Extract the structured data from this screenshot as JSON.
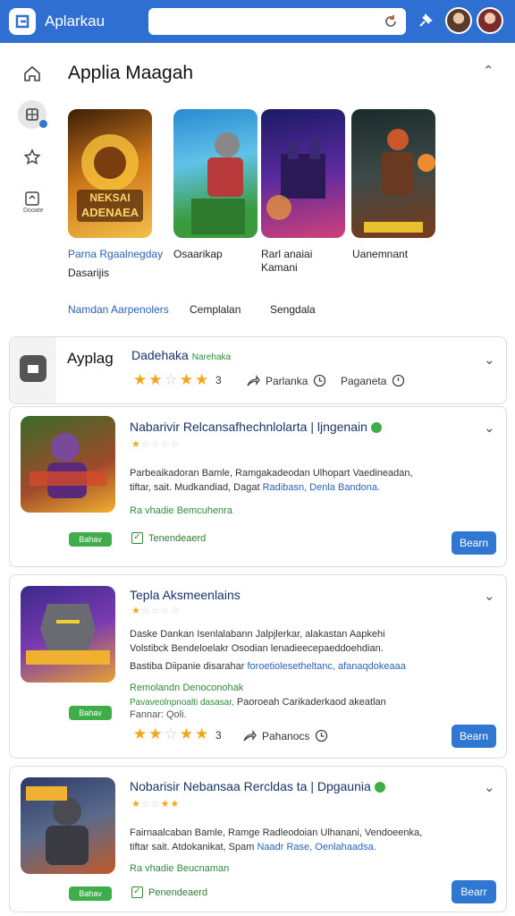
{
  "app": {
    "name": "Aplarkau"
  },
  "search": {
    "placeholder": ""
  },
  "page": {
    "title": "Applia Maagah"
  },
  "sidebar": {
    "apps_label": "Dooate"
  },
  "featured": [
    {
      "title_line1": "Parna Rgaalnegday",
      "title_line2": "Dasarijis",
      "art_text_1": "NEKSAI",
      "art_text_2": "ADENAEA"
    },
    {
      "title_line1": "Osaarikap",
      "title_line2": "",
      "art_text_1": "",
      "art_text_2": ""
    },
    {
      "title_line1": "Rarl anaiai",
      "title_line2": "Kamani",
      "art_text_1": "",
      "art_text_2": ""
    },
    {
      "title_line1": "Uanemnant",
      "title_line2": "",
      "art_text_1": "",
      "art_text_2": ""
    }
  ],
  "tabs": [
    "Namdan Aarpenolers",
    "Cemplalan",
    "Sengdala"
  ],
  "cards": [
    {
      "heading": "Ayplag",
      "title": "Dadehaka",
      "title_tag": "Narehaka",
      "rating_count": "3",
      "meta1": "Parlanka",
      "meta2": "Paganeta"
    },
    {
      "title": "Nabarivir Relcansafhechnlolarta | ljngenain",
      "desc_line1": "Parbeaikadoran Bamle, Ramgakadeodan Ulhopart Vaedineadan,",
      "desc_line2": "tiftar, sait. Mudkandiad, Dagat",
      "desc_link": "Radibasn, Denla Bandona.",
      "green_line": "Ra vhadie Bemcuhenra",
      "pill": "Bahav",
      "check_label": "Tenendeaerd",
      "button": "Bearn"
    },
    {
      "title": "Tepla Aksmeenlains",
      "desc_line1": "Daske Dankan Isenlalabann Jalpjlerkar, alakastan Aapkehi",
      "desc_line2": "Volstibck Bendeloelakr Osodian lenadieecepaeddoehdian.",
      "desc_line3": "Bastiba Diipanie disarahar",
      "desc_link": "foroetiolesetheltanc, afanaqdokeaaa",
      "green_line1": "Remolandn Denoconohak",
      "green_line2": "Pavaveolnpnoalti dasasar,",
      "green_line2_rest": "Paoroeah Carikaderkaod akeatlan",
      "grey_line": "Fannar: Qoli.",
      "pill": "Bahav",
      "rating_count": "3",
      "meta1": "Pahanocs",
      "button": "Bearn"
    },
    {
      "title": "Nobarisir Nebansaa Rercldas ta | Dpgaunia",
      "desc_line1": "Fairnaalcaban Bamle, Ramge Radleodoian Ulhanani, Vendoeenka,",
      "desc_line2": "tiftar sait. Atdokanikat, Spam",
      "desc_link": "Naadr Rase, Oenlahaadsa.",
      "green_line": "Ra vhadie Beucnaman",
      "pill": "Bahav",
      "check_label": "Penendeaerd",
      "button": "Bearr"
    }
  ],
  "colors": {
    "accent": "#2f6fd1",
    "button": "#2f77d1",
    "green": "#3fae4a",
    "star": "#f2a618"
  }
}
